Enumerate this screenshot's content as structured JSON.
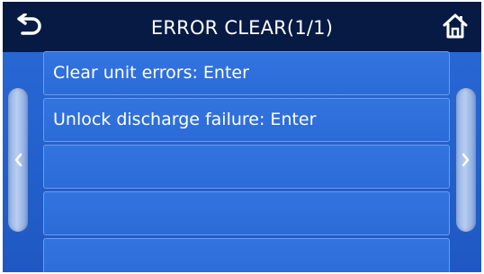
{
  "header": {
    "title": "ERROR CLEAR(1/1)",
    "back_icon": "return-arrow-icon",
    "home_icon": "home-icon"
  },
  "menu": {
    "items": [
      {
        "label": "Clear unit errors: Enter"
      },
      {
        "label": "Unlock discharge failure: Enter"
      },
      {
        "label": ""
      },
      {
        "label": ""
      },
      {
        "label": ""
      }
    ]
  },
  "navigation": {
    "prev_icon": "chevron-left-icon",
    "next_icon": "chevron-right-icon"
  },
  "colors": {
    "header_bg": "#061a44",
    "screen_bg": "#2563cf",
    "item_border": "#6f9be6",
    "text": "#ffffff"
  }
}
